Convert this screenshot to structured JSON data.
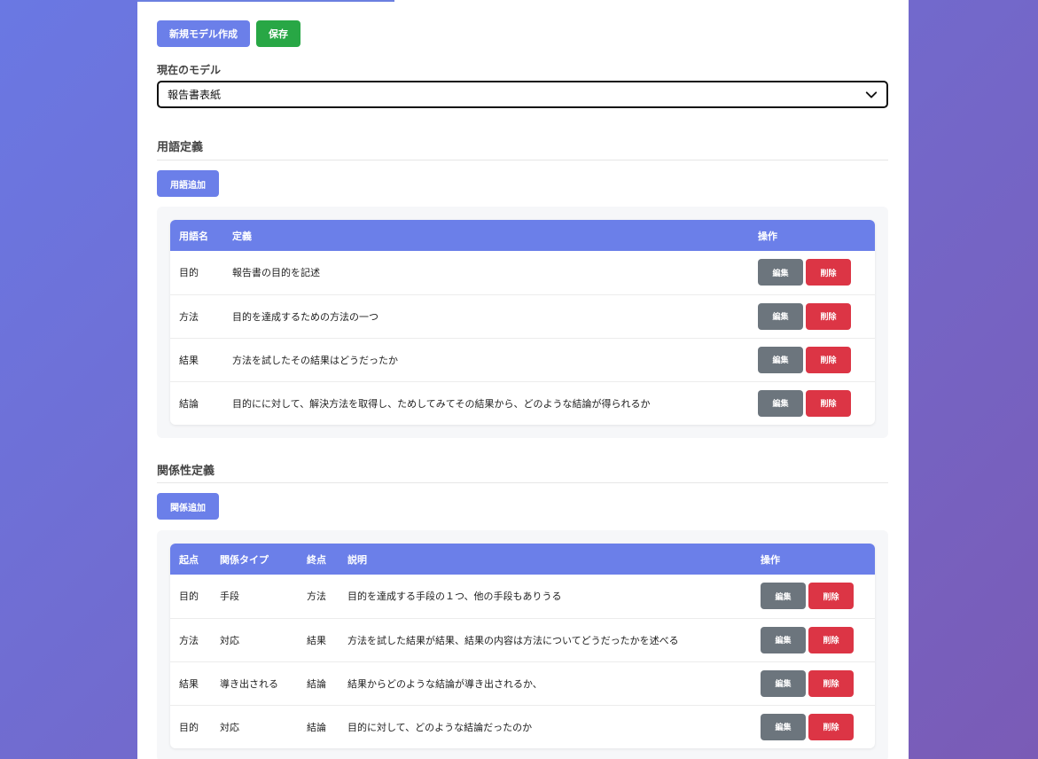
{
  "toolbar": {
    "new_model_label": "新規モデル作成",
    "save_label": "保存"
  },
  "model": {
    "label": "現在のモデル",
    "selected": "報告書表紙"
  },
  "terms": {
    "title": "用語定義",
    "add_label": "用語追加",
    "headers": {
      "name": "用語名",
      "definition": "定義",
      "actions": "操作"
    },
    "rows": [
      {
        "name": "目的",
        "definition": "報告書の目的を記述"
      },
      {
        "name": "方法",
        "definition": "目的を達成するための方法の一つ"
      },
      {
        "name": "結果",
        "definition": "方法を試したその結果はどうだったか"
      },
      {
        "name": "結論",
        "definition": "目的にに対して、解決方法を取得し、ためしてみてその結果から、どのような結論が得られるか"
      }
    ]
  },
  "relations": {
    "title": "関係性定義",
    "add_label": "関係追加",
    "headers": {
      "from": "起点",
      "type": "関係タイプ",
      "to": "終点",
      "description": "説明",
      "actions": "操作"
    },
    "rows": [
      {
        "from": "目的",
        "type": "手段",
        "to": "方法",
        "description": "目的を達成する手段の１つ、他の手段もありうる"
      },
      {
        "from": "方法",
        "type": "対応",
        "to": "結果",
        "description": "方法を試した結果が結果、結果の内容は方法についてどうだったかを述べる"
      },
      {
        "from": "結果",
        "type": "導き出される",
        "to": "結論",
        "description": "結果からどのような結論が導き出されるか、"
      },
      {
        "from": "目的",
        "type": "対応",
        "to": "結論",
        "description": "目的に対して、どのような結論だったのか"
      }
    ]
  },
  "actions": {
    "edit_label": "編集",
    "delete_label": "削除"
  },
  "colors": {
    "primary": "#6b7fe9",
    "success": "#28a745",
    "secondary": "#6c757d",
    "danger": "#dc3545"
  },
  "icons": {
    "select_arrow": "chevron-down-icon"
  }
}
